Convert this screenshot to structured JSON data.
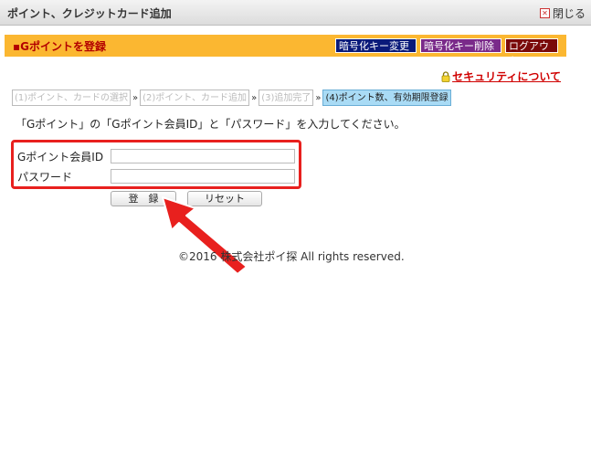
{
  "window": {
    "title": "ポイント、クレジットカード追加",
    "close_label": "閉じる"
  },
  "header": {
    "title": "▪Gポイントを登録",
    "buttons": [
      {
        "label": "暗号化キー変更",
        "color": "#0a1a7a"
      },
      {
        "label": "暗号化キー削除",
        "color": "#7a2a8a"
      },
      {
        "label": "ログアウト",
        "color": "#7a0a0a"
      }
    ]
  },
  "security_link": "セキュリティについて",
  "steps": [
    {
      "label": "(1)ポイント、カードの選択",
      "active": false
    },
    {
      "label": "(2)ポイント、カード追加",
      "active": false
    },
    {
      "label": "(3)追加完了",
      "active": false
    },
    {
      "label": "(4)ポイント数、有効期限登録",
      "active": true
    }
  ],
  "step_separator": "»",
  "instruction": "「Gポイント」の「Gポイント会員ID」と「パスワード」を入力してください。",
  "form": {
    "member_id_label": "Gポイント会員ID",
    "member_id_value": "",
    "password_label": "パスワード",
    "password_value": ""
  },
  "buttons": {
    "register": "登　録",
    "reset": "リセット"
  },
  "footer": {
    "copyright": "©2016 株式会社ポイ探 All rights reserved."
  },
  "colors": {
    "header_bg": "#fbb731",
    "highlight_red": "#e8201e",
    "active_step": "#a9dbf5"
  }
}
